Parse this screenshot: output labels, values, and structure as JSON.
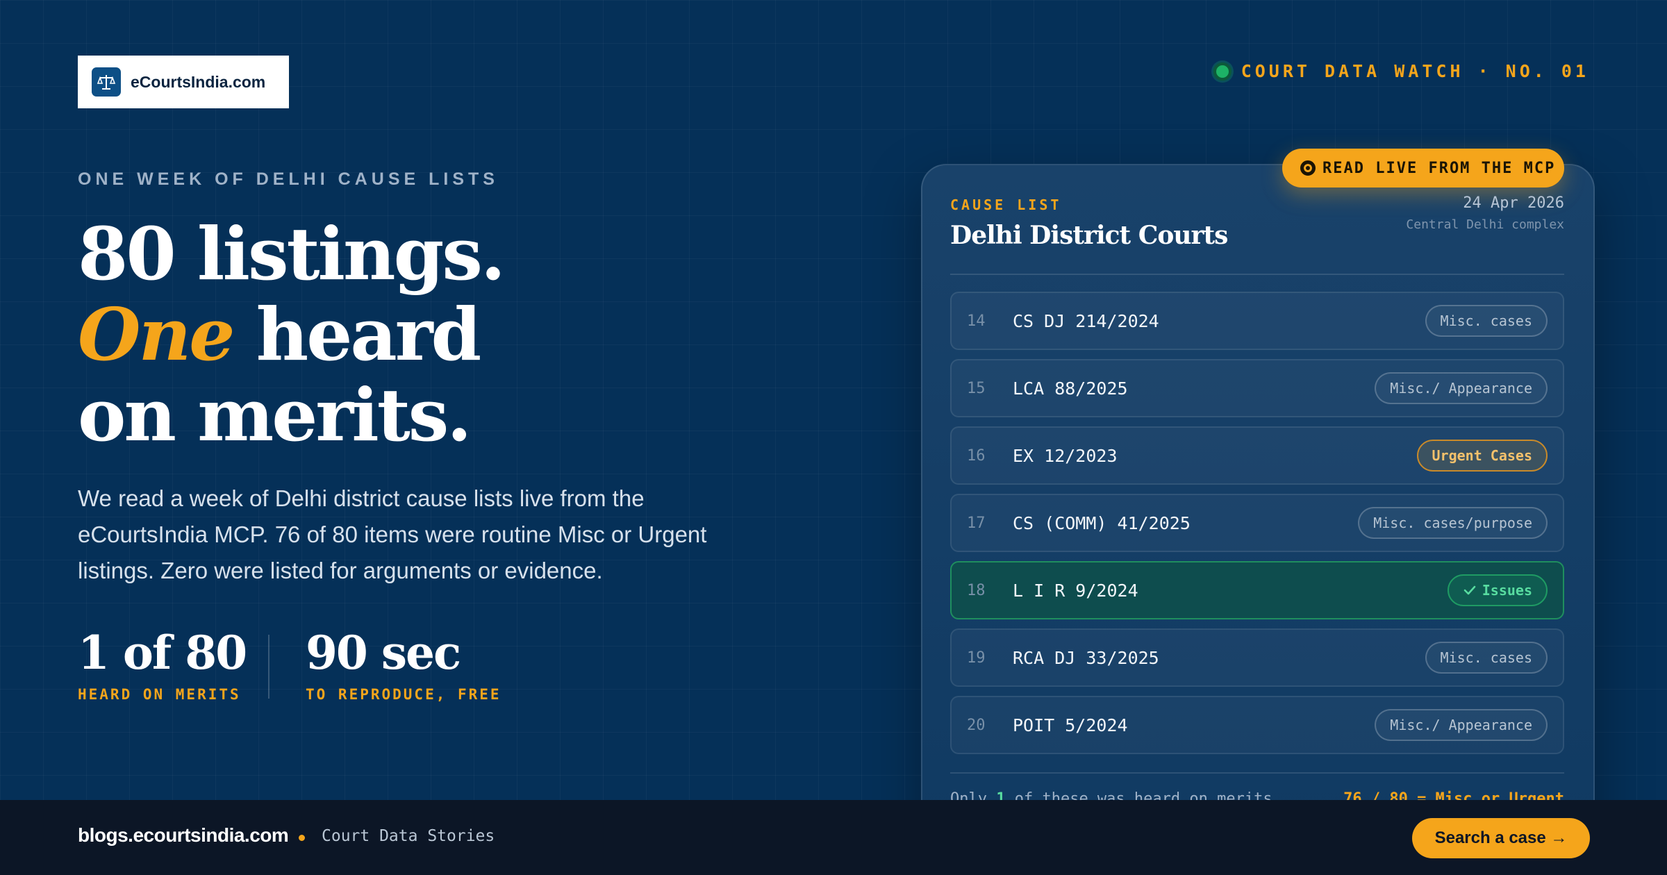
{
  "logo": {
    "text": "eCourtsIndia.com",
    "icon": "scales-of-justice-icon"
  },
  "kicker": {
    "label": "COURT DATA WATCH · NO. 01",
    "status_color": "#1db366"
  },
  "eyebrow": "ONE WEEK OF DELHI CAUSE LISTS",
  "headline": {
    "line1": "80 listings.",
    "accent": "One",
    "line2_rest": " heard",
    "line3": "on merits."
  },
  "lede": "We read a week of Delhi district cause lists live from the eCourtsIndia MCP. 76 of 80 items were routine Misc or Urgent listings. Zero were listed for arguments or evidence.",
  "stats": [
    {
      "value": "1 of 80",
      "label": "HEARD ON MERITS"
    },
    {
      "value": "90 sec",
      "label": "TO REPRODUCE, FREE"
    }
  ],
  "card": {
    "live_pill": "READ LIVE FROM THE MCP",
    "kicker": "CAUSE LIST",
    "title": "Delhi District Courts",
    "date": "24 Apr 2026",
    "complex": "Central Delhi complex",
    "rows": [
      {
        "num": "14",
        "case": "CS DJ 214/2024",
        "purpose": "Misc. cases"
      },
      {
        "num": "15",
        "case": "LCA 88/2025",
        "purpose": "Misc./ Appearance"
      },
      {
        "num": "16",
        "case": "EX 12/2023",
        "purpose": "Urgent Cases"
      },
      {
        "num": "17",
        "case": "CS (COMM) 41/2025",
        "purpose": "Misc. cases/purpose"
      },
      {
        "num": "18",
        "case": "L I R 9/2024",
        "purpose": "Issues"
      },
      {
        "num": "19",
        "case": "RCA DJ 33/2025",
        "purpose": "Misc. cases"
      },
      {
        "num": "20",
        "case": "POIT 5/2024",
        "purpose": "Misc./ Appearance"
      }
    ],
    "footer_left_pre": "Only ",
    "footer_left_num": "1",
    "footer_left_post": " of these was heard on merits",
    "footer_right": "76 / 80 = Misc or Urgent"
  },
  "bottom": {
    "site": "blogs.ecourtsindia.com",
    "tagline": "Court Data Stories",
    "cta": "Search a case →"
  },
  "colors": {
    "accent": "#f5a51b",
    "background": "#053058",
    "success": "#1db366"
  }
}
